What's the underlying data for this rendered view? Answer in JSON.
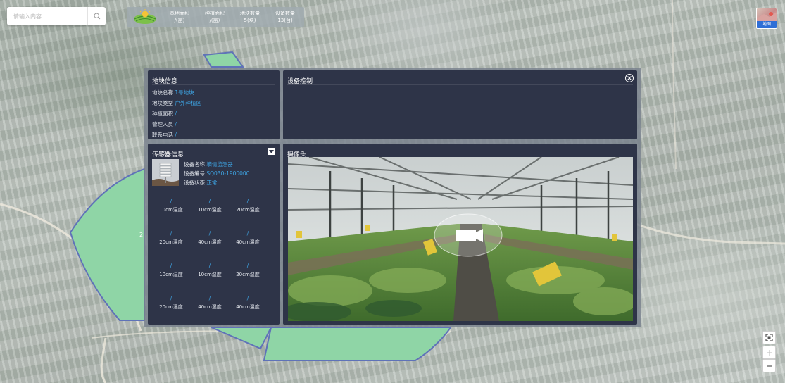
{
  "search": {
    "placeholder": "请输入内容"
  },
  "stats": [
    {
      "label": "基地面积",
      "value": "/(亩)"
    },
    {
      "label": "种植面积",
      "value": "/(亩)"
    },
    {
      "label": "地块数量",
      "value": "5(块)"
    },
    {
      "label": "设备数量",
      "value": "13(台)"
    }
  ],
  "map_type": {
    "label": "地图"
  },
  "map_text": {
    "plot_label": "2"
  },
  "info_panel": {
    "title": "地块信息",
    "rows": [
      {
        "label": "地块名称",
        "value": "1号地块"
      },
      {
        "label": "地块类型",
        "value": "户外种植区"
      },
      {
        "label": "种植面积",
        "value": "/"
      },
      {
        "label": "管理人员",
        "value": "/"
      },
      {
        "label": "联系电话",
        "value": "/"
      }
    ]
  },
  "control_panel": {
    "title": "设备控制"
  },
  "sensor_panel": {
    "title": "传感器信息",
    "device": {
      "name_label": "设备名称",
      "name": "墒情监测器",
      "code_label": "设备编号",
      "code": "SQ030-1900000",
      "status_label": "设备状态",
      "status": "正常"
    },
    "readings": [
      {
        "value": "/",
        "label": "10cm温度"
      },
      {
        "value": "/",
        "label": "10cm温度"
      },
      {
        "value": "/",
        "label": "20cm温度"
      },
      {
        "value": "/",
        "label": "20cm温度"
      },
      {
        "value": "/",
        "label": "40cm温度"
      },
      {
        "value": "/",
        "label": "40cm温度"
      },
      {
        "value": "/",
        "label": "10cm温度"
      },
      {
        "value": "/",
        "label": "10cm温度"
      },
      {
        "value": "/",
        "label": "20cm温度"
      },
      {
        "value": "/",
        "label": "20cm湿度"
      },
      {
        "value": "/",
        "label": "40cm湿度"
      },
      {
        "value": "/",
        "label": "40cm温度"
      }
    ]
  },
  "camera_panel": {
    "title": "摄像头"
  },
  "colors": {
    "panel_bg": "#2e3448",
    "value_blue": "#3ea6e6",
    "plot_fill": "#8fd5a6",
    "plot_border": "#5f72b8"
  }
}
